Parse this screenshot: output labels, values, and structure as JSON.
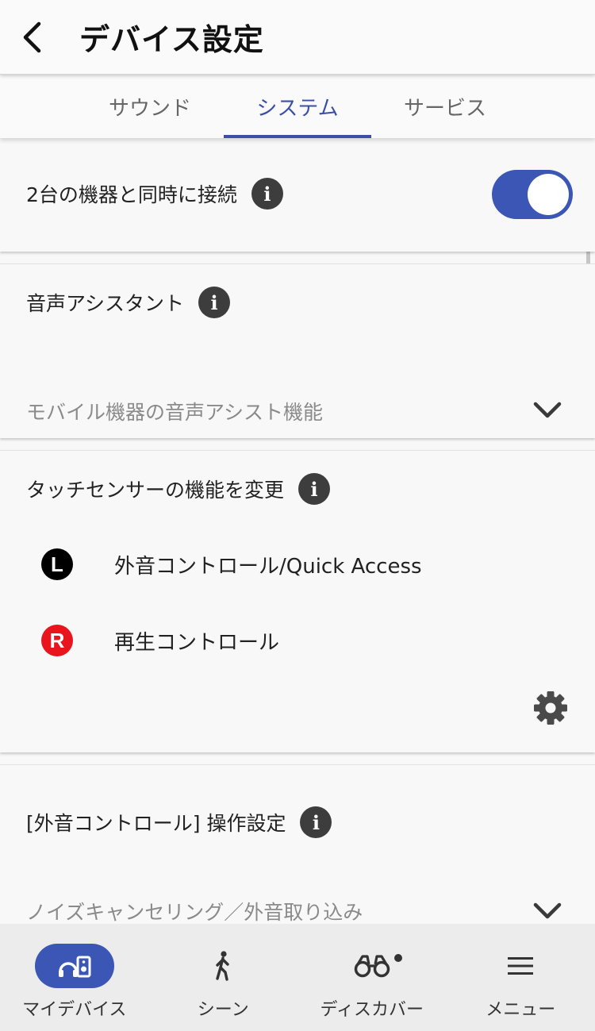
{
  "header": {
    "title": "デバイス設定"
  },
  "tabs": [
    {
      "label": "サウンド"
    },
    {
      "label": "システム"
    },
    {
      "label": "サービス"
    }
  ],
  "active_tab": "システム",
  "settings": {
    "dual_connect": {
      "label": "2台の機器と同時に接続",
      "enabled": true
    },
    "voice_assistant": {
      "label": "音声アシスタント",
      "value": "モバイル機器の音声アシスト機能"
    },
    "touch_sensor": {
      "label": "タッチセンサーの機能を変更",
      "left": {
        "badge": "L",
        "label": "外音コントロール/Quick Access"
      },
      "right": {
        "badge": "R",
        "label": "再生コントロール"
      }
    },
    "ambient_control": {
      "label": "[外音コントロール] 操作設定",
      "value": "ノイズキャンセリング／外音取り込み"
    }
  },
  "bottom_nav": [
    {
      "label": "マイデバイス",
      "icon": "my-device-icon",
      "active": true
    },
    {
      "label": "シーン",
      "icon": "walking-person-icon",
      "active": false
    },
    {
      "label": "ディスカバー",
      "icon": "binoculars-icon",
      "active": false,
      "badge_dot": true
    },
    {
      "label": "メニュー",
      "icon": "hamburger-menu-icon",
      "active": false
    }
  ],
  "colors": {
    "accent": "#3b56b5",
    "tab_active": "#3b4fa8",
    "right_badge": "#e8141e",
    "left_badge": "#000000"
  }
}
